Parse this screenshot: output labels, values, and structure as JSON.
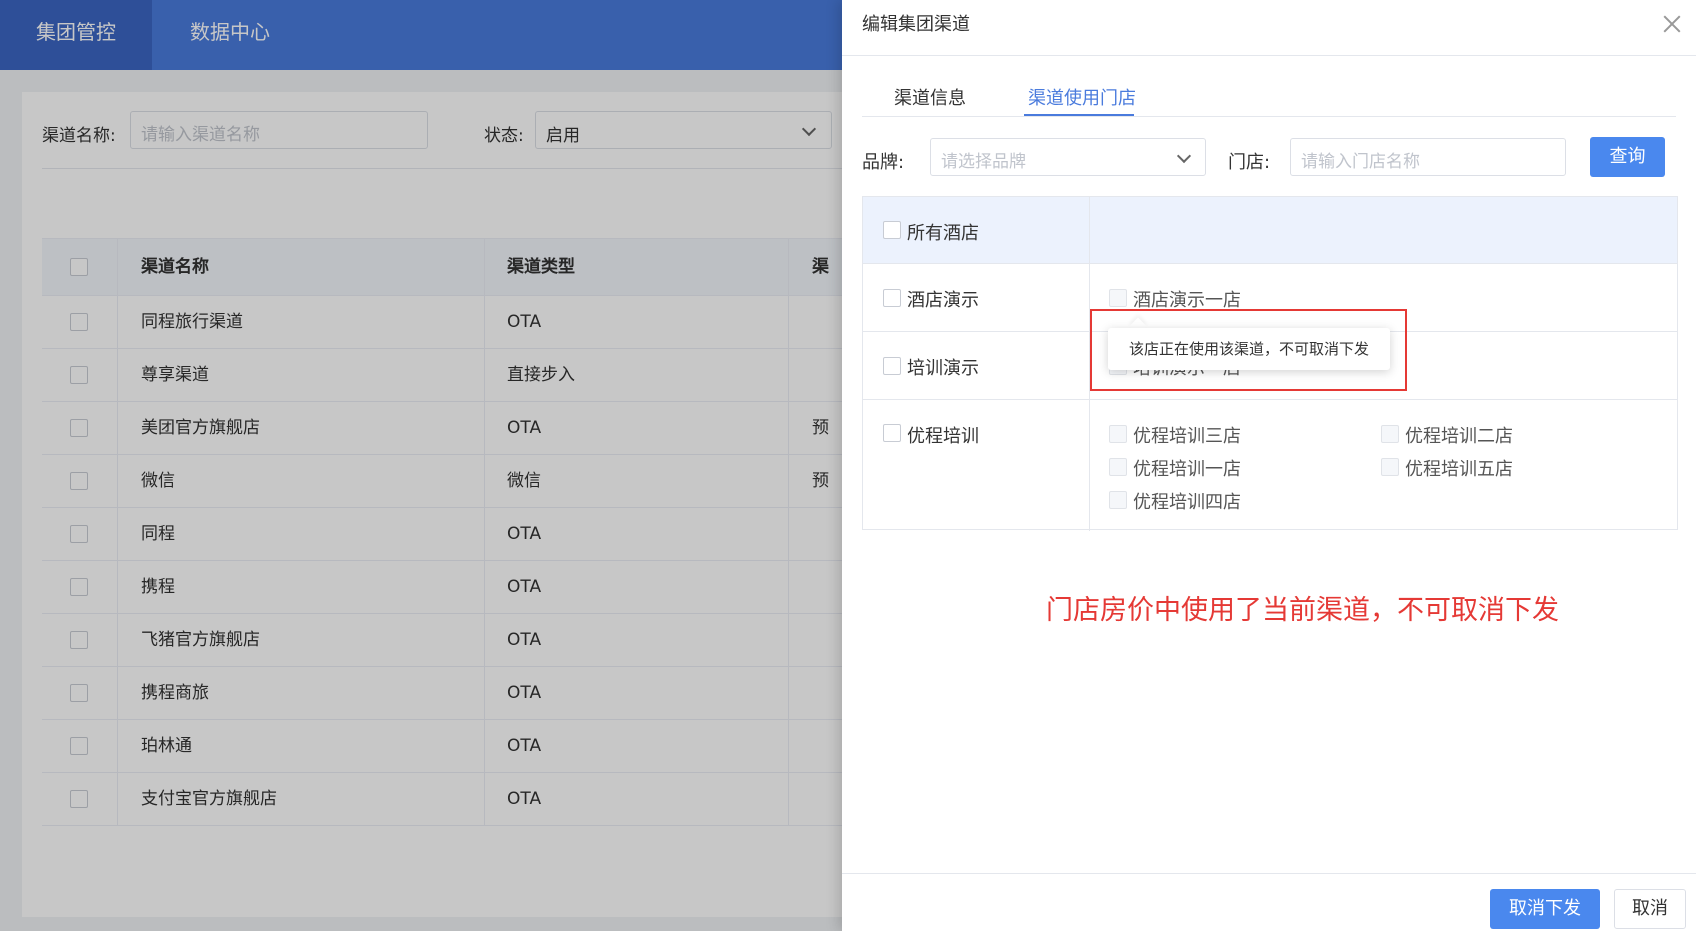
{
  "topnav": {
    "items": [
      "集团管控",
      "数据中心"
    ]
  },
  "filters": {
    "name_label": "渠道名称:",
    "name_placeholder": "请输入渠道名称",
    "status_label": "状态:",
    "status_value": "启用"
  },
  "table": {
    "headers": [
      "渠道名称",
      "渠道类型",
      "渠道"
    ],
    "rows": [
      {
        "name": "同程旅行渠道",
        "type": "OTA",
        "extra": ""
      },
      {
        "name": "尊享渠道",
        "type": "直接步入",
        "extra": ""
      },
      {
        "name": "美团官方旗舰店",
        "type": "OTA",
        "extra": "预订"
      },
      {
        "name": "微信",
        "type": "微信",
        "extra": "预订"
      },
      {
        "name": "同程",
        "type": "OTA",
        "extra": ""
      },
      {
        "name": "携程",
        "type": "OTA",
        "extra": ""
      },
      {
        "name": "飞猪官方旗舰店",
        "type": "OTA",
        "extra": ""
      },
      {
        "name": "携程商旅",
        "type": "OTA",
        "extra": ""
      },
      {
        "name": "珀林通",
        "type": "OTA",
        "extra": ""
      },
      {
        "name": "支付宝官方旗舰店",
        "type": "OTA",
        "extra": ""
      }
    ]
  },
  "drawer": {
    "title": "编辑集团渠道",
    "tabs": [
      "渠道信息",
      "渠道使用门店"
    ],
    "brand_label": "品牌:",
    "brand_placeholder": "请选择品牌",
    "store_label": "门店:",
    "store_placeholder": "请输入门店名称",
    "query_button": "查询",
    "all_hotels": "所有酒店",
    "groups": [
      {
        "name": "酒店演示",
        "stores": [
          "酒店演示一店"
        ]
      },
      {
        "name": "培训演示",
        "stores": [
          "培训演示一店"
        ]
      },
      {
        "name": "优程培训",
        "stores": [
          "优程培训三店",
          "优程培训二店",
          "优程培训一店",
          "优程培训五店",
          "优程培训四店"
        ]
      }
    ],
    "tooltip": "该店正在使用该渠道，不可取消下发",
    "annotation": "门店房价中使用了当前渠道，不可取消下发",
    "cancel_distribute_button": "取消下发",
    "cancel_button": "取消"
  },
  "colors": {
    "primary": "#4a7bdd",
    "annotation_red": "#e53935"
  }
}
